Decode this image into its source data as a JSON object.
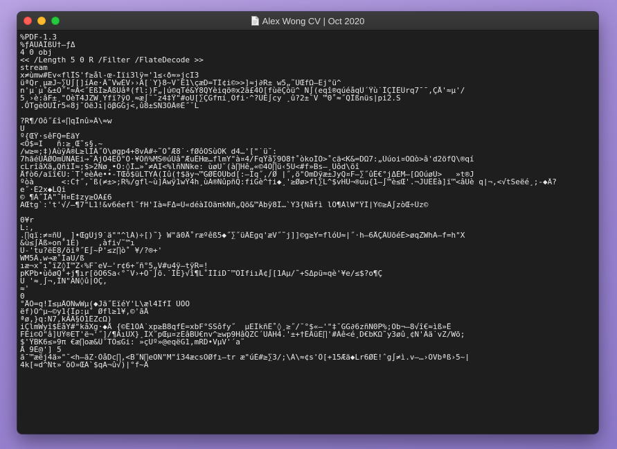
{
  "window": {
    "title": "Alex Wong CV | Oct 2020",
    "title_icon": "document-icon"
  },
  "colors": {
    "window_bg": "#1e1e1e",
    "text": "#e8e8e8",
    "titlebar": "#363636",
    "close": "#fe5f57",
    "minimize": "#febc2e",
    "maximize": "#28c840"
  },
  "lines": [
    "%PDF-1.3",
    "%ƒÂÚÂÎßÛ†–ƒΔ",
    "4 0 obj",
    "<< /Length 5 0 R /Filter /FlateDecode >>",
    "stream",
    "x≠ùmw#Ev«flÏS'f≥ål-œ-Íïi3lÿ='1≤‹ð≈»jcI3",
    "üªQr˛µæJ~∑Û∫[]íÂe·Ä˜VwÈV››Â[˙Y}8~V˘Ê1\\çæD=TÍ¢i©>>]≈j∂R±_w5„˜ÙŒfΩ–Ej°ü^",
    "n'µ˙µ˚&±Ò˝\"≈Â<˝ÈßÏ≥ÅßÙâª(fl:)F„|ú©qTé&Y8QYèiqö®x2ã£4O[fùëÇòü^_Ñ∫(eqî®qúéåqÛ´Ÿù˙ÏÇÎÊÛrq7¯¯,ÇÅ'≈µ'/",
    "5¸›è:âF±¸\"ÕèT4JZW¸Yfï?ÿO¸≈æ∫˘˜z4‡Ÿ\"#oÜ[∑ÇGfπi¸Õfi·^?ÚÉ∫cy ¸û?2±˘V_™0˚≈˝QÏßnüs|pi2.S",
    ".ÓTgèOÜÏr5«8j¯ÖëJı|öβGGj<,û8±SN3OÄ®È˝˘L",
    "",
    "?R¶/Òô˝£î«∏qÏnû»Ä\\≈w",
    "Ü",
    "º{ŒŸ·sêFQ=ÉäY",
    "<Ô$=I   ñ:≥¸Œ˜s§.~",
    "/w≥∞;‡)ÀùÿÂ®L≥lÏÂ˝Ô\\øgp4+8vÂ#÷˜O˚Æ8˙·fØôÕSùÖK d4…'[\"˙ü˘:",
    "7hãéÙÅØÕmÙNÀEi→˜ÄjÖ4ÉÖ°Ò·¥Õñ%MS®úÙâ\"ÆuËHœ…flmY\"à¤4/FqŸå∑9Ò8†˚òkoÍÓ>˚cä<K&=DΩ7:„Ùúoi¤OΩò>â'd2öfQ\\®qí",
    "cLrîâXã„QñïÏ≈;$>2Nø¸•Ö:◊Í…»˚≠AI<%lñÑÑke: ùøÜ˘(à∏Hê„«©4Õ∏ü‹5Ü<#f»Bs–¸Ûôd\\õî",
    "Åfò6/aïî€Ü:˙T'eèÀe••-TŒõ$üLTYÀ(Iû(†$äy¬™GØÈOÛbd[:–Íq˝,/Ø_|˝,ö\"ÕmDÿæ±JyQ¤F–∑˝ûË€°jΔÈM–[ΩOúøÙ>   »t®J",
    "ºòà      <:C†˝,˘ß(≠±>;R%/gfl~ù]Äwÿ1wŸ4h¸ùÀ®ÑûpñQ:fiGè^†i◆¸'≥Øø>fl∑L^$vHÚ¬®uu{1–∫™è≤Œ'.¬JUÊÊà]ï™<âUè q|¬,<√tSeëé¸;-◆Ä?",
    "e˝·É2x◆LQi",
    "©_¶À˝ÏA\"˜H¤Ê‡zy≥ÕA£6",
    "AŒtg`:'t'√/–¶7\"L1!&v6éefl˘fH'Ià≈FΔ=Ú«déàIOäπkÑñ„Qö&™Äbÿ8Î…`Y3{Ñåfì_lÕ¶ÀlW\"ŸÌ|Y©≥Â∫zòŒ÷Ûz©",
    "",
    "0¥r",
    "L:,",
    ".∏qï:≠¤ñÛ¸_]•ŒgÛj9˙ä\"\"^lÁ)÷[)˜}_W\"ã0Å˚ræºêß5◆˝∑˝üÄÈgq'æV˝˜j]]©g≥Y=flóÜ≈|˝·h–6ÅÇÄÛõéÉ>øqZWhÃ–f=h\"X",
    "&ù≤∫Åß»on˚1É)    ,àfi√˜™ı",
    "Û-'tu?ëÈ8/öiª˝È∫~P'≤z∏ò˚ ¥/?®+'",
    "WM5Ä.w→æ˚ÏaU/ß",
    "ıæ¬x˚ı˚ïZ◊Í™Z‹%F¯eV–'r¢6+˝ñ°5„V#u4ÿ–tÿR=!",
    "pKPb•ùôøQ˚+j¶ır[öÖ6Sa‹°˘V›+Õ˘∫õ.˙ÏE}√î¶L˚ÍÍiD¯™ÓÌfiıÅ¢∫[1Aµ/˜+SΔpü≈qè'¥e/≤$?o¶Ç",
    "U_'≈¸∫¬,ÎN\"ÃÑ◊û|OÇ,",
    "≈'",
    "0",
    "°ÅÒ=q!Ï≤µÄÖNwWµ(◆Jä˝EïéY'L\\æl4IfI_ÙÒÖ",
    "ëf)O^µ~©y1{Ïρ:µ˚_Øfl≥1¥,©'ãÅ",
    "ªø,}q:Ñ7,kÀÄ§Ô1ÊZcΩ)",
    "iÇlmWyî$EåY#\"kåXg·◆Å {©Ê1ÒÁ˙xp≥B8qfÈ=xbF°SSôfy˝ _µEÎkñË˚◊¸≥˝/˘°$«–'\"‡˘GG∂6zñN0P%;Ob¬–8√î€≈ìß»Ë",
    "FEi©O\"â]ÜŸ®ET'ë¬'˝]/¶ÀıÙX}¸ÎX˝pŒµ¤zÊâBÙ€nv^≥wp9HâQZC´ÜÁH4.'±+†ÉÄüÉ∏'#Àê<é¸D€bKΩ˜y3øû¸¢N'Âä˙vZ/Wõ;",
    "$'ŸBK6≤»9π €æ∏oæ&Û˝TÕ≤Gi: »çÜº»@eqëG1,mRD•VµV'´a˜",
    "Å 9È@'] 5",
    "ã¯™æëj4ä»\"˘<h–ãZ·ÒåDc∏,<B˝Ñ∏eÖÑ\"M\"î34æcsÖØfı–tr_æ\"úÈ#≥∑3/;\\À\\≈¢s'Ô[+15Æä◆Lr6ØÈ!ˆg∫≠ì.v–…›ÕVbªß›5~|",
    "4k[≈d^Ñt»˝õO»ŒÀ`$qA¬û√)|°f~Ä"
  ]
}
